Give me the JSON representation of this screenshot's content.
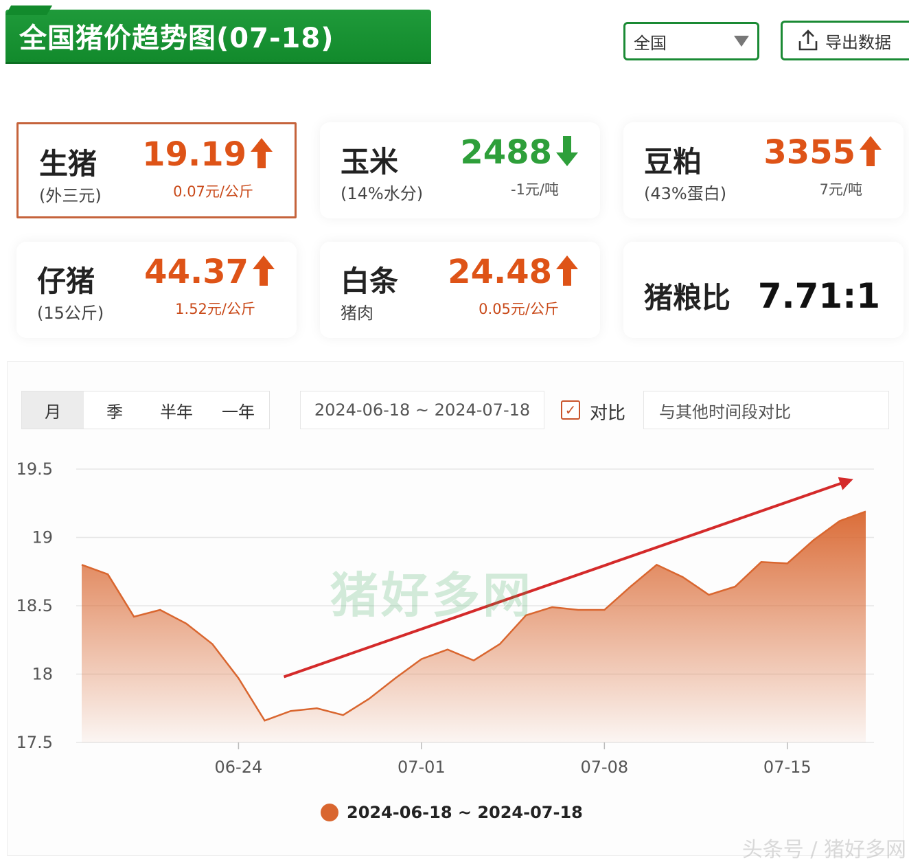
{
  "header": {
    "title": "全国猪价趋势图(07-18)",
    "region": "全国",
    "export_label": "导出数据"
  },
  "cards": [
    {
      "name": "生猪",
      "sub": "(外三元)",
      "value": "19.19",
      "direction": "up",
      "change": "0.07元/公斤"
    },
    {
      "name": "玉米",
      "sub": "(14%水分)",
      "value": "2488",
      "direction": "down",
      "change": "-1元/吨"
    },
    {
      "name": "豆粕",
      "sub": "(43%蛋白)",
      "value": "3355",
      "direction": "up",
      "change": "7元/吨"
    },
    {
      "name": "仔猪",
      "sub": "(15公斤)",
      "value": "44.37",
      "direction": "up",
      "change": "1.52元/公斤"
    },
    {
      "name": "白条",
      "sub": "猪肉",
      "value": "24.48",
      "direction": "up",
      "change": "0.05元/公斤"
    },
    {
      "name": "猪粮比",
      "value": "7.71:1"
    }
  ],
  "controls": {
    "tabs": [
      "月",
      "季",
      "半年",
      "一年"
    ],
    "active_tab": "月",
    "date_range": "2024-06-18 ~ 2024-07-18",
    "compare_checked": true,
    "compare_label": "对比",
    "compare_placeholder": "与其他时间段对比"
  },
  "colors": {
    "brand_green": "#1a8a34",
    "up": "#de5317",
    "down": "#2e9f3a",
    "area": "#d9662f",
    "trend_arrow": "#d42a2a"
  },
  "watermark": "猪好多网",
  "credit": "头条号 / 猪好多网",
  "chart_data": {
    "type": "area",
    "title": "",
    "xlabel": "",
    "ylabel": "",
    "x": [
      "06-18",
      "06-19",
      "06-20",
      "06-21",
      "06-22",
      "06-23",
      "06-24",
      "06-25",
      "06-26",
      "06-27",
      "06-28",
      "06-29",
      "06-30",
      "07-01",
      "07-02",
      "07-03",
      "07-04",
      "07-05",
      "07-06",
      "07-07",
      "07-08",
      "07-09",
      "07-10",
      "07-11",
      "07-12",
      "07-13",
      "07-14",
      "07-15",
      "07-16",
      "07-17",
      "07-18"
    ],
    "series": [
      {
        "name": "2024-06-18 ~ 2024-07-18",
        "values": [
          18.8,
          18.73,
          18.42,
          18.47,
          18.37,
          18.22,
          17.97,
          17.66,
          17.73,
          17.75,
          17.7,
          17.82,
          17.97,
          18.11,
          18.18,
          18.1,
          18.22,
          18.43,
          18.49,
          18.47,
          18.47,
          18.64,
          18.8,
          18.71,
          18.58,
          18.64,
          18.82,
          18.81,
          18.98,
          19.12,
          19.19
        ]
      }
    ],
    "x_ticks": [
      "06-24",
      "07-01",
      "07-08",
      "07-15"
    ],
    "y_ticks": [
      17.5,
      18,
      18.5,
      19,
      19.5
    ],
    "ylim": [
      17.5,
      19.5
    ],
    "grid": true,
    "legend_position": "bottom-center",
    "annotation": "upward trend arrow"
  }
}
